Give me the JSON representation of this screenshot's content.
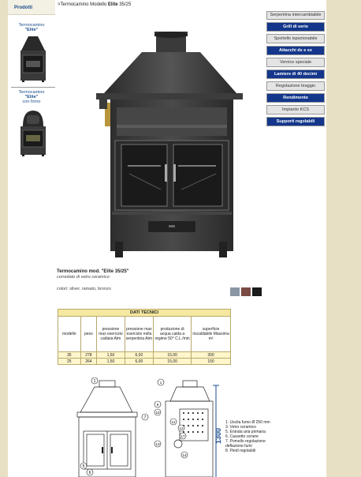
{
  "sidebar": {
    "title": "Prodotti",
    "items": [
      {
        "line1": "Termocamino",
        "line2": "\"Elite\"",
        "line3": ""
      },
      {
        "line1": "Termocamino",
        "line2": "\"Elite\"",
        "line3": "con forno"
      }
    ]
  },
  "breadcrumb": {
    "prefix": ">Termocamino Modello ",
    "model": "Elite",
    "suffix": " 35/25"
  },
  "menu": [
    {
      "label": "Serpentina intercambiabile",
      "style": "grey"
    },
    {
      "label": "Grill di serie",
      "style": "blue"
    },
    {
      "label": "Sportello ispezionabile",
      "style": "grey"
    },
    {
      "label": "Attacchi dx e sx",
      "style": "blue"
    },
    {
      "label": "Vernice speciale",
      "style": "grey"
    },
    {
      "label": "Lamiere di 40 decimi",
      "style": "blue"
    },
    {
      "label": "Regolazione tiraggio",
      "style": "grey"
    },
    {
      "label": "Rendimento",
      "style": "blue"
    },
    {
      "label": "Impianto KCS",
      "style": "grey"
    },
    {
      "label": "Supporti regolabili",
      "style": "blue"
    }
  ],
  "product": {
    "title": "Termocamino mod. \"Elite 35/25\"",
    "subtitle": "corredato di vetro ceramico",
    "colors_text": "colori: silver, ramato, bronzo",
    "swatches": [
      "#8a96a4",
      "#7a4a44",
      "#1a1a1a"
    ]
  },
  "tech_table": {
    "title": "DATI TECNICI",
    "headers": [
      "modello",
      "peso",
      "pressione max esercizio caldaia Atm",
      "pressione max esercizio nella serpentina Atm",
      "produzione di acqua calda a regime 50° C.L./min",
      "superficie riscaldabile Massima m²"
    ],
    "rows": [
      [
        "35",
        "278",
        "1,50",
        "6,00",
        "15,00",
        "300"
      ],
      [
        "25",
        "264",
        "1,50",
        "6,00",
        "15,00",
        "150"
      ]
    ]
  },
  "diagram": {
    "height_label": "1300",
    "callouts": [
      "1",
      "7",
      "9",
      "10",
      "11",
      "12",
      "13",
      "14",
      "17",
      "5",
      "6"
    ],
    "legend": [
      "1. Uscita fumo Ø 250 mm",
      "3. Vetro ceramico",
      "5. Entrata aria primaria",
      "6. Cassetto cenere",
      "7. Pomello regolazione deflazione fumi",
      "8. Piedi regolabili"
    ]
  }
}
